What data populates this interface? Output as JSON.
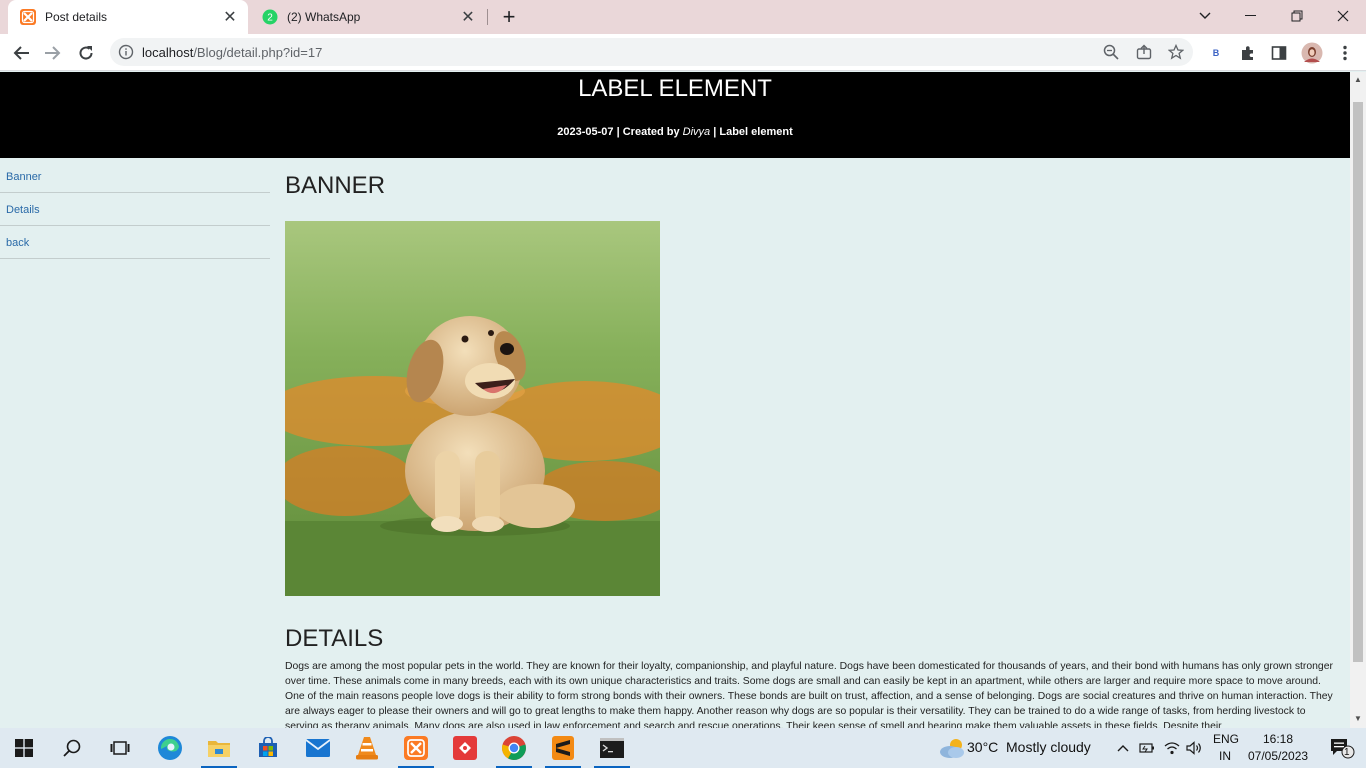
{
  "browser": {
    "tabs": [
      {
        "title": "Post details",
        "active": true
      },
      {
        "title": "(2) WhatsApp",
        "active": false
      }
    ],
    "url_host": "localhost",
    "url_path": "/Blog/detail.php?id=17",
    "profile_badge": "B"
  },
  "header": {
    "title": "LABEL ELEMENT",
    "date": "2023-05-07",
    "created_by_prefix": " | Created by ",
    "author": "Divya",
    "sep": " | ",
    "category": "Label element"
  },
  "sidebar": {
    "items": [
      {
        "label": "Banner"
      },
      {
        "label": "Details"
      },
      {
        "label": "back"
      }
    ]
  },
  "main": {
    "banner_heading": "BANNER",
    "details_heading": "DETAILS",
    "details_text": "Dogs are among the most popular pets in the world. They are known for their loyalty, companionship, and playful nature. Dogs have been domesticated for thousands of years, and their bond with humans has only grown stronger over time. These animals come in many breeds, each with its own unique characteristics and traits. Some dogs are small and can easily be kept in an apartment, while others are larger and require more space to move around. One of the main reasons people love dogs is their ability to form strong bonds with their owners. These bonds are built on trust, affection, and a sense of belonging. Dogs are social creatures and thrive on human interaction. They are always eager to please their owners and will go to great lengths to make them happy. Another reason why dogs are so popular is their versatility. They can be trained to do a wide range of tasks, from herding livestock to serving as therapy animals. Many dogs are also used in law enforcement and search and rescue operations. Their keen sense of smell and hearing make them valuable assets in these fields. Despite their"
  },
  "taskbar": {
    "weather_temp": "30°C",
    "weather_desc": "Mostly cloudy",
    "lang_1": "ENG",
    "lang_2": "IN",
    "time": "16:18",
    "date": "07/05/2023",
    "notification_count": "1"
  },
  "colors": {
    "page_bg": "#e3f0f0",
    "header_bg": "#000000",
    "link": "#2a6aa8",
    "tabstrip": "#ead7d9"
  }
}
